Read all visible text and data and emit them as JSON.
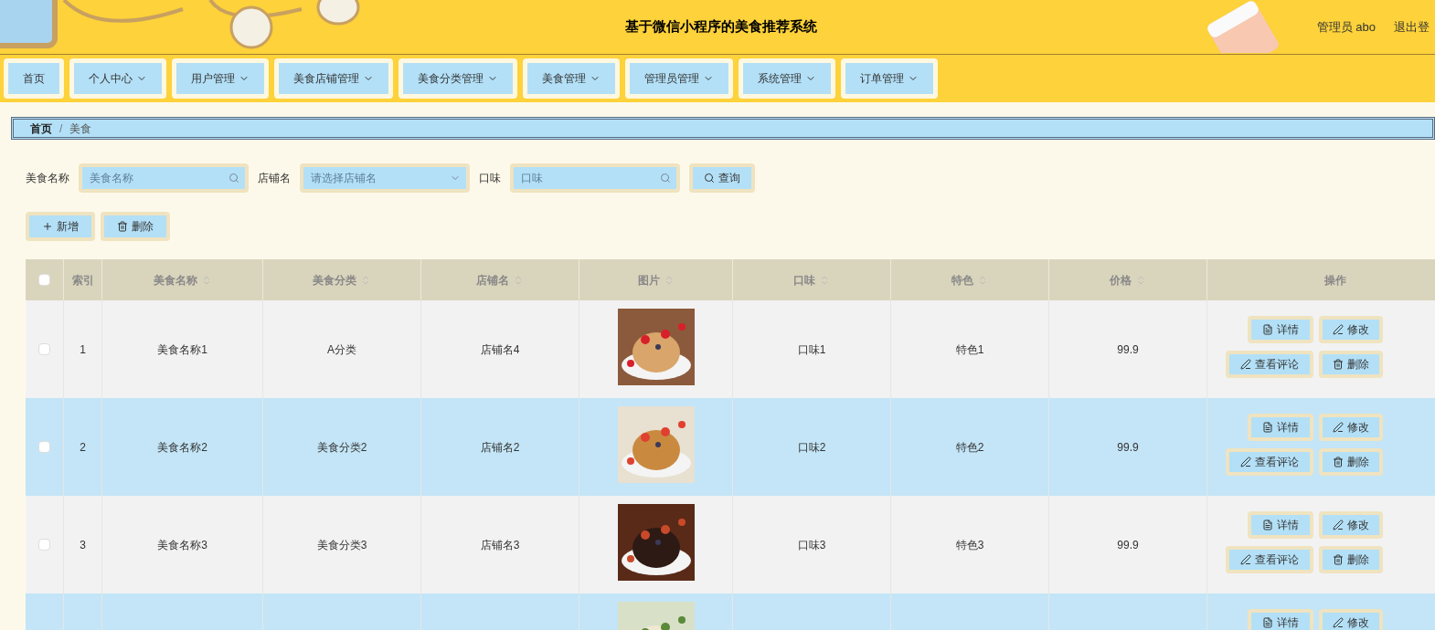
{
  "header": {
    "title": "基于微信小程序的美食推荐系统",
    "user": "管理员 abo",
    "logout": "退出登"
  },
  "nav": [
    {
      "label": "首页",
      "dropdown": false
    },
    {
      "label": "个人中心",
      "dropdown": true
    },
    {
      "label": "用户管理",
      "dropdown": true
    },
    {
      "label": "美食店铺管理",
      "dropdown": true
    },
    {
      "label": "美食分类管理",
      "dropdown": true
    },
    {
      "label": "美食管理",
      "dropdown": true
    },
    {
      "label": "管理员管理",
      "dropdown": true
    },
    {
      "label": "系统管理",
      "dropdown": true
    },
    {
      "label": "订单管理",
      "dropdown": true
    }
  ],
  "breadcrumb": {
    "items": [
      "首页",
      "美食"
    ],
    "separator": "/"
  },
  "filters": [
    {
      "label": "美食名称",
      "placeholder": "美食名称",
      "kind": "input"
    },
    {
      "label": "店铺名",
      "placeholder": "请选择店铺名",
      "kind": "select"
    },
    {
      "label": "口味",
      "placeholder": "口味",
      "kind": "input"
    }
  ],
  "search_button": "查询",
  "actions": [
    {
      "label": "新增",
      "kind": "add"
    },
    {
      "label": "删除",
      "kind": "delete"
    }
  ],
  "table": {
    "select_all_checked": false,
    "columns": [
      {
        "label": "索引",
        "sortable": false
      },
      {
        "label": "美食名称",
        "sortable": true
      },
      {
        "label": "美食分类",
        "sortable": true
      },
      {
        "label": "店铺名",
        "sortable": true
      },
      {
        "label": "图片",
        "sortable": true
      },
      {
        "label": "口味",
        "sortable": true
      },
      {
        "label": "特色",
        "sortable": true
      },
      {
        "label": "价格",
        "sortable": true
      },
      {
        "label": "操作",
        "sortable": false
      }
    ],
    "rows": [
      {
        "checked": false,
        "index": "1",
        "name": "美食名称1",
        "category": "A分类",
        "shop": "店铺名4",
        "flavor": "口味1",
        "feature": "特色1",
        "price": "99.9",
        "buttons": [
          {
            "label": "详情",
            "kind": "detail"
          },
          {
            "label": "修改",
            "kind": "edit"
          },
          {
            "label": "查看评论",
            "kind": "comments"
          },
          {
            "label": "删除",
            "kind": "delete"
          }
        ]
      },
      {
        "checked": false,
        "index": "2",
        "name": "美食名称2",
        "category": "美食分类2",
        "shop": "店铺名2",
        "flavor": "口味2",
        "feature": "特色2",
        "price": "99.9",
        "buttons": [
          {
            "label": "详情",
            "kind": "detail"
          },
          {
            "label": "修改",
            "kind": "edit"
          },
          {
            "label": "查看评论",
            "kind": "comments"
          },
          {
            "label": "删除",
            "kind": "delete"
          }
        ]
      },
      {
        "checked": false,
        "index": "3",
        "name": "美食名称3",
        "category": "美食分类3",
        "shop": "店铺名3",
        "flavor": "口味3",
        "feature": "特色3",
        "price": "99.9",
        "buttons": [
          {
            "label": "详情",
            "kind": "detail"
          },
          {
            "label": "修改",
            "kind": "edit"
          },
          {
            "label": "查看评论",
            "kind": "comments"
          },
          {
            "label": "删除",
            "kind": "delete"
          }
        ]
      },
      {
        "buttons": [
          {
            "label": "详情",
            "kind": "detail"
          },
          {
            "label": "修改",
            "kind": "edit"
          }
        ]
      }
    ]
  }
}
